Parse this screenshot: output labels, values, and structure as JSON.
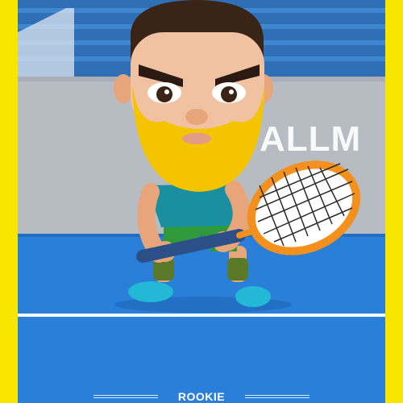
{
  "scene": {
    "banner_text": "ALLM",
    "rank_label": "ROOKIE"
  },
  "colors": {
    "border": "#f7e600",
    "court": "#2a7fd8",
    "court_line": "#ffffff",
    "stadium_seats": "#2f6fb6",
    "wall": "#b7bcc3",
    "beard": "#f5c400",
    "racket": "#f4911e",
    "shirt": "#1a8fa0",
    "shorts": "#2f9a3a",
    "shoes": "#22b8d6"
  },
  "icons": [
    "tennis-player-character",
    "tennis-racket"
  ]
}
